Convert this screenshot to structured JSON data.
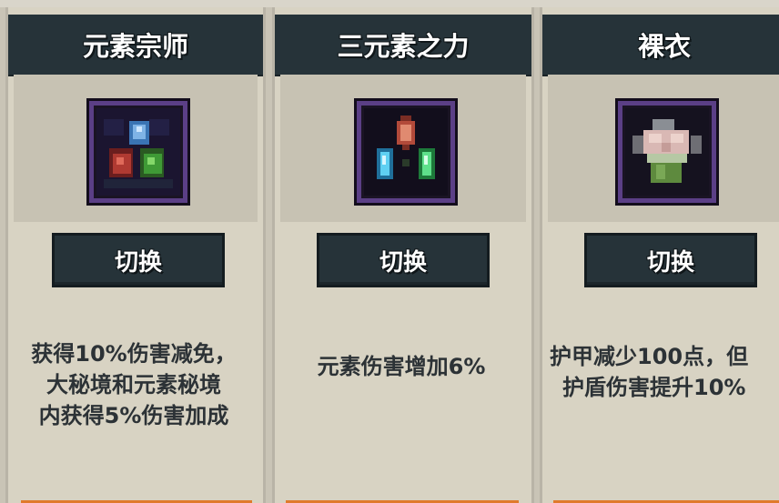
{
  "cards": [
    {
      "title": "元素宗师",
      "button_label": "切换",
      "icon": "elemental-gems-icon",
      "description_lines": [
        "获得10%伤害减免，",
        "大秘境和元素秘境",
        "内获得5%伤害加成"
      ]
    },
    {
      "title": "三元素之力",
      "button_label": "切换",
      "icon": "three-crystals-icon",
      "description_lines": [
        "元素伤害增加6%"
      ]
    },
    {
      "title": "裸衣",
      "button_label": "切换",
      "icon": "bare-torso-icon",
      "description_lines": [
        "护甲减少100点，但",
        "护盾伤害提升10%"
      ]
    }
  ],
  "colors": {
    "background": "#c9c4b6",
    "card": "#d8d3c3",
    "header": "#263339",
    "button": "#263339",
    "icon_frame": "#5b3f86",
    "text": "#2c3236",
    "accent_bar": "#e07a2c"
  }
}
